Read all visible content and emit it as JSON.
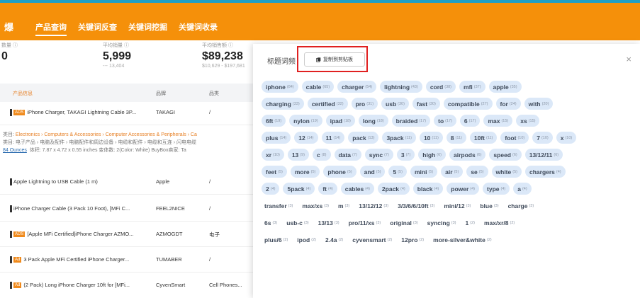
{
  "header": {
    "brand": "爆",
    "tabs": [
      "产品查询",
      "关键词反查",
      "关键词挖掘",
      "关键词收录"
    ]
  },
  "stats": [
    {
      "label": "数量 ⓘ",
      "value": "0",
      "sub": ""
    },
    {
      "label": "平均销量 ⓘ",
      "value": "5,999",
      "sub": "--- 13,404"
    },
    {
      "label": "平均销售额 ⓘ",
      "value": "$89,238",
      "sub": "$10,629 - $197,681"
    }
  ],
  "table": {
    "headers": [
      "产品信息",
      "品牌",
      "品类"
    ],
    "rows": [
      {
        "badge": "ADS",
        "title": "iPhone Charger, TAKAGI Lightning Cable 3P...",
        "brand": "TAKAGI",
        "category": "/"
      },
      {
        "badge": "",
        "title": "Apple Lightning to USB Cable (1 m)",
        "brand": "Apple",
        "category": "/"
      },
      {
        "badge": "",
        "title": "iPhone Charger Cable (3 Pack 10 Foot), [MFi C...",
        "brand": "FEEL2NICE",
        "category": "/"
      },
      {
        "badge": "ADS",
        "title": "[Apple MFi Certified]iPhone Charger AZMO...",
        "brand": "AZMOGDT",
        "category": "电子"
      },
      {
        "badge": "Ad",
        "title": "3 Pack Apple MFi Certified iPhone Charger...",
        "brand": "TUMABER",
        "category": "/"
      },
      {
        "badge": "Ad",
        "title": "(2 Pack) Long iPhone Charger 10ft for [MFi...",
        "brand": "CyvenSmart",
        "category": "Cell Phones..."
      }
    ],
    "detail": {
      "line1_label": "类目: ",
      "line1_link": "Electronics › Computers & Accessories › Computer Accessories & Peripherals › Ca",
      "line2": "类目: 电子产品 › 电脑及配件 › 电脑配件和周边设备 › 电缆和配件 › 电缆和互连 › 闪电电缆",
      "line3_weight": "84 Ounces",
      "line3_rest": "体积: 7.87 x 4.72 x 0.55 inches   变体数: 2(Color: White)   BuyBox卖家: Ta"
    }
  },
  "popup": {
    "title": "标题词频",
    "copy_label": "复制到剪贴板",
    "close": "×",
    "rows": [
      [
        [
          "iphone",
          "84"
        ],
        [
          "cable",
          "65"
        ],
        [
          "charger",
          "54"
        ],
        [
          "lightning",
          "43"
        ],
        [
          "cord",
          "38"
        ],
        [
          "mfi",
          "37"
        ],
        [
          "apple",
          "35"
        ]
      ],
      [
        [
          "charging",
          "33"
        ],
        [
          "certified",
          "32"
        ],
        [
          "pro",
          "31"
        ],
        [
          "usb",
          "30"
        ],
        [
          "fast",
          "30"
        ],
        [
          "compatible",
          "27"
        ],
        [
          "for",
          "24"
        ],
        [
          "with",
          "20"
        ]
      ],
      [
        [
          "6ft",
          "19"
        ],
        [
          "nylon",
          "19"
        ],
        [
          "ipad",
          "18"
        ],
        [
          "long",
          "18"
        ],
        [
          "braided",
          "17"
        ],
        [
          "to",
          "17"
        ],
        [
          "6",
          "17"
        ],
        [
          "max",
          "15"
        ],
        [
          "xs",
          "15"
        ]
      ],
      [
        [
          "plus",
          "14"
        ],
        [
          "12",
          "14"
        ],
        [
          "11",
          "14"
        ],
        [
          "pack",
          "13"
        ],
        [
          "3pack",
          "11"
        ],
        [
          "10",
          "11"
        ],
        [
          "8",
          "11"
        ],
        [
          "10ft",
          "11"
        ],
        [
          "foot",
          "10"
        ],
        [
          "7",
          "10"
        ],
        [
          "x",
          "10"
        ]
      ],
      [
        [
          "xr",
          "10"
        ],
        [
          "13",
          "9"
        ],
        [
          "c",
          "8"
        ],
        [
          "data",
          "7"
        ],
        [
          "sync",
          "7"
        ],
        [
          "3",
          "7"
        ],
        [
          "high",
          "6"
        ],
        [
          "airpods",
          "6"
        ],
        [
          "speed",
          "6"
        ],
        [
          "13/12/11",
          "6"
        ]
      ],
      [
        [
          "feet",
          "5"
        ],
        [
          "more",
          "5"
        ],
        [
          "phone",
          "5"
        ],
        [
          "and",
          "5"
        ],
        [
          "5",
          "5"
        ],
        [
          "mini",
          "5"
        ],
        [
          "air",
          "5"
        ],
        [
          "se",
          "5"
        ],
        [
          "white",
          "5"
        ],
        [
          "chargers",
          "4"
        ]
      ],
      [
        [
          "2",
          "4"
        ],
        [
          "5pack",
          "4"
        ],
        [
          "ft",
          "4"
        ],
        [
          "cables",
          "4"
        ],
        [
          "2pack",
          "4"
        ],
        [
          "black",
          "4"
        ],
        [
          "power",
          "4"
        ],
        [
          "type",
          "4"
        ],
        [
          "a",
          "4"
        ]
      ],
      [
        [
          "transfer",
          "3"
        ],
        [
          "max/xs",
          "3"
        ],
        [
          "m",
          "3"
        ],
        [
          "13/12/12",
          "3"
        ],
        [
          "3/3/6/6/10ft",
          "3"
        ],
        [
          "mini/12",
          "3"
        ],
        [
          "blue",
          "3"
        ],
        [
          "charge",
          "3"
        ]
      ],
      [
        [
          "6s",
          "3"
        ],
        [
          "usb-c",
          "3"
        ],
        [
          "13/13",
          "3"
        ],
        [
          "pro/11/xs",
          "3"
        ],
        [
          "original",
          "3"
        ],
        [
          "syncing",
          "3"
        ],
        [
          "1",
          "2"
        ],
        [
          "max/xr/8",
          "2"
        ]
      ],
      [
        [
          "plus/6",
          "2"
        ],
        [
          "ipod",
          "2"
        ],
        [
          "2.4a",
          "2"
        ],
        [
          "cyvensmart",
          "2"
        ],
        [
          "12pro",
          "2"
        ],
        [
          "more-silver&white",
          "2"
        ]
      ]
    ]
  },
  "colors": {
    "accent": "#f5900a",
    "chip_bg": "#dbe8f8",
    "highlight": "#e02020"
  }
}
